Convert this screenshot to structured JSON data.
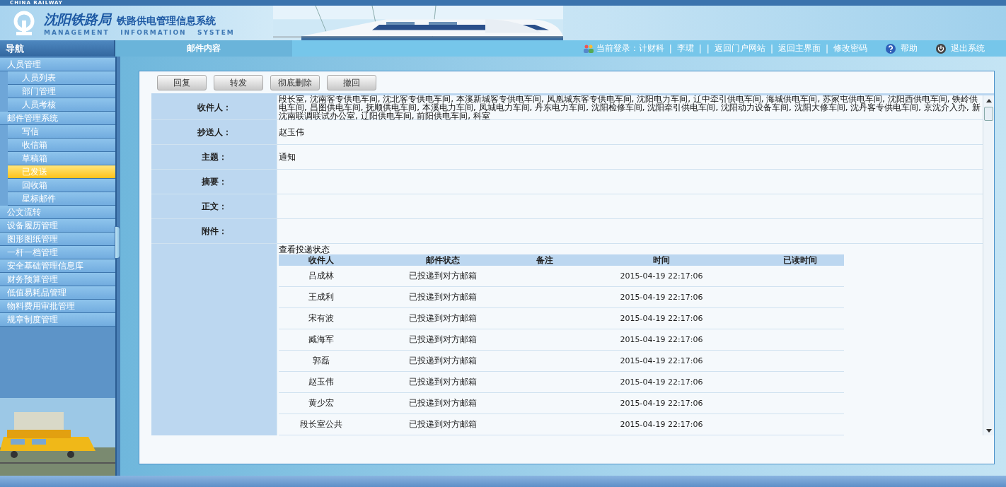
{
  "header": {
    "top_label": "CHINA RAILWAY",
    "org_name": "沈阳铁路局",
    "system_name": "铁路供电管理信息系统",
    "subtitle": "MANAGEMENT   INFORMATION   SYSTEM"
  },
  "nav_title": "导航",
  "page_tab": "邮件内容",
  "user_bar": [
    {
      "kind": "login",
      "text": "当前登录：计财科"
    },
    {
      "kind": "sep",
      "text": "|"
    },
    {
      "kind": "link",
      "text": "李珺"
    },
    {
      "kind": "sep",
      "text": "|"
    },
    {
      "kind": "sep",
      "text": "|"
    },
    {
      "kind": "link",
      "text": "返回门户网站"
    },
    {
      "kind": "sep",
      "text": "|"
    },
    {
      "kind": "link",
      "text": "返回主界面"
    },
    {
      "kind": "sep",
      "text": "|"
    },
    {
      "kind": "link",
      "text": "修改密码"
    },
    {
      "kind": "help",
      "text": "帮助"
    },
    {
      "kind": "exit",
      "text": "退出系统"
    }
  ],
  "sidebar": {
    "items": [
      {
        "label": "人员管理",
        "selected": false,
        "children": [
          {
            "label": "人员列表",
            "selected": false
          },
          {
            "label": "部门管理",
            "selected": false
          },
          {
            "label": "人员考核",
            "selected": false
          }
        ]
      },
      {
        "label": "邮件管理系统",
        "selected": false,
        "children": [
          {
            "label": "写信",
            "selected": false
          },
          {
            "label": "收信箱",
            "selected": false
          },
          {
            "label": "草稿箱",
            "selected": false
          },
          {
            "label": "已发送",
            "selected": true
          },
          {
            "label": "回收箱",
            "selected": false
          },
          {
            "label": "星标邮件",
            "selected": false
          }
        ]
      },
      {
        "label": "公文流转",
        "selected": false
      },
      {
        "label": "设备履历管理",
        "selected": false
      },
      {
        "label": "图形图纸管理",
        "selected": false
      },
      {
        "label": "一杆一档管理",
        "selected": false
      },
      {
        "label": "安全基础管理信息库",
        "selected": false
      },
      {
        "label": "财务预算管理",
        "selected": false
      },
      {
        "label": "低值易耗品管理",
        "selected": false
      },
      {
        "label": "物料费用审批管理",
        "selected": false
      },
      {
        "label": "规章制度管理",
        "selected": false
      }
    ]
  },
  "toolbar": [
    "回复",
    "转发",
    "彻底删除",
    "撤回"
  ],
  "fields": [
    {
      "label": "收件人：",
      "value": "段长室, 沈南客专供电车间, 沈北客专供电车间, 本溪新城客专供电车间, 凤凰城东客专供电车间, 沈阳电力车间, 辽中牵引供电车间, 海城供电车间, 苏家屯供电车间, 沈阳西供电车间, 铁岭供电车间, 昌图供电车间, 抚顺供电车间, 本溪电力车间, 凤城电力车间, 丹东电力车间, 沈阳检修车间, 沈阳牵引供电车间, 沈阳动力设备车间, 沈阳大修车间, 沈丹客专供电车间, 京沈介入办, 新沈南联调联试办公室, 辽阳供电车间, 前阳供电车间, 科室"
    },
    {
      "label": "抄送人：",
      "value": "赵玉伟"
    },
    {
      "label": "主题：",
      "value": "通知"
    },
    {
      "label": "摘要："
    },
    {
      "label": "正文："
    },
    {
      "label": "附件："
    }
  ],
  "delivery": {
    "title": "查看投递状态",
    "columns": [
      "收件人",
      "邮件状态",
      "备注",
      "时间",
      "已读时间"
    ],
    "rows": [
      [
        "吕成林",
        "已投递到对方邮箱",
        "2015-04-19 22:17:06"
      ],
      [
        "王成利",
        "已投递到对方邮箱",
        "2015-04-19 22:17:06"
      ],
      [
        "宋有波",
        "已投递到对方邮箱",
        "2015-04-19 22:17:06"
      ],
      [
        "臧海军",
        "已投递到对方邮箱",
        "2015-04-19 22:17:06"
      ],
      [
        "郭磊",
        "已投递到对方邮箱",
        "2015-04-19 22:17:06"
      ],
      [
        "赵玉伟",
        "已投递到对方邮箱",
        "2015-04-19 22:17:06"
      ],
      [
        "黄少宏",
        "已投递到对方邮箱",
        "2015-04-19 22:17:06"
      ],
      [
        "段长室公共",
        "已投递到对方邮箱",
        "2015-04-19 22:17:06"
      ]
    ]
  }
}
